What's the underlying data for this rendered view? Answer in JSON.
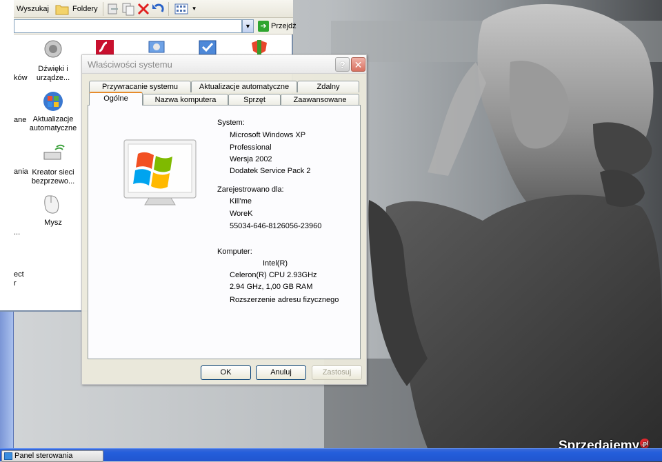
{
  "explorer": {
    "toolbar": {
      "search_label": "Wyszukaj",
      "folders_label": "Foldery"
    },
    "address": {
      "value": "",
      "go_label": "Przejdź"
    },
    "icons": [
      {
        "label": "Dźwięki i urządze...",
        "icon": "speaker-icon"
      },
      {
        "label": "Aktualizacje automatyczne",
        "icon": "windows-update-icon"
      },
      {
        "label": "Kreator sieci bezprzewo...",
        "icon": "wireless-network-icon"
      },
      {
        "label": "Mysz",
        "icon": "mouse-icon"
      }
    ],
    "cut_labels": [
      "ków",
      "ane",
      "ania",
      "...",
      "ect",
      "r"
    ]
  },
  "dialog": {
    "title": "Właściwości systemu",
    "tabs_row1": [
      "Przywracanie systemu",
      "Aktualizacje automatyczne",
      "Zdalny"
    ],
    "tabs_row2": [
      "Ogólne",
      "Nazwa komputera",
      "Sprzęt",
      "Zaawansowane"
    ],
    "active_tab": "Ogólne",
    "system": {
      "heading": "System:",
      "lines": [
        "Microsoft Windows XP",
        "Professional",
        "Wersja 2002",
        "Dodatek Service Pack 2"
      ]
    },
    "registered": {
      "heading": "Zarejestrowano dla:",
      "lines": [
        "Kill'me",
        "WoreK",
        "55034-646-8126056-23960"
      ]
    },
    "computer": {
      "heading": "Komputer:",
      "lines": [
        "Intel(R)",
        "Celeron(R) CPU 2.93GHz",
        "2.94 GHz, 1,00 GB RAM",
        "Rozszerzenie adresu fizycznego"
      ]
    },
    "buttons": {
      "ok": "OK",
      "cancel": "Anuluj",
      "apply": "Zastosuj"
    }
  },
  "taskbar": {
    "item_label": "Panel sterowania"
  },
  "watermark": {
    "text": "Sprzedajemy",
    "badge": ".pl"
  }
}
